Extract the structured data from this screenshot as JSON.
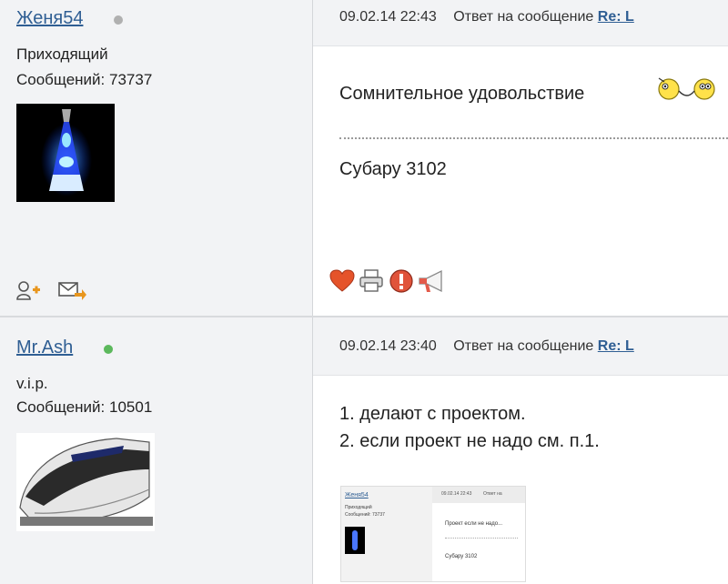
{
  "posts": [
    {
      "username": "Женя54",
      "status": "offline",
      "rank": "Приходящий",
      "messages_label": "Сообщений: 73737",
      "date": "09.02.14 22:43",
      "reply_text": "Ответ на сообщение",
      "reply_link": "Re: L",
      "text_line": "Сомнительное удовольствие",
      "signature": "Субару 3102",
      "avatar_icon": "lava-lamp-icon",
      "profile_icons": [
        "add-friend-icon",
        "send-message-icon"
      ],
      "action_icons": [
        "like-heart-icon",
        "print-icon",
        "report-icon",
        "megaphone-icon"
      ]
    },
    {
      "username": "Mr.Ash",
      "status": "online",
      "rank": "v.i.p.",
      "messages_label": "Сообщений: 10501",
      "date": "09.02.14 23:40",
      "reply_text": "Ответ на сообщение",
      "reply_link": "Re: L",
      "lines": [
        "1. делают с проектом.",
        "2. если проект не надо см. п.1."
      ],
      "avatar_icon": "train-icon",
      "thumbnail": {
        "username": "Женя54",
        "rank": "Приходящий",
        "messages_label": "Сообщений: 73737",
        "date": "09.02.14 22:43",
        "reply_text": "Ответ на",
        "text_line": "Проект если не надо...",
        "signature": "Субару 3102"
      }
    }
  ],
  "colors": {
    "link": "#2f5e93",
    "online": "#5cb85c",
    "offline": "#b0b0b0",
    "panel": "#f2f3f5"
  }
}
